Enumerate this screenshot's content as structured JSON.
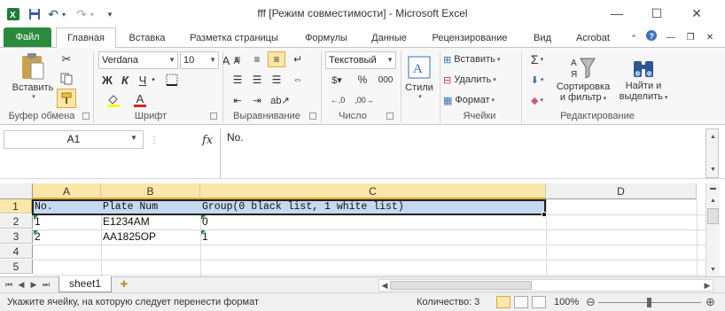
{
  "window": {
    "title": "fff  [Режим совместимости] - Microsoft Excel",
    "minimize": "—",
    "maximize": "☐",
    "close": "✕"
  },
  "qat": {
    "undo": "↶",
    "redo": "↷",
    "customize": "▾"
  },
  "tabs": {
    "file": "Файл",
    "home": "Главная",
    "insert": "Вставка",
    "layout": "Разметка страницы",
    "formulas": "Формулы",
    "data": "Данные",
    "review": "Рецензирование",
    "view": "Вид",
    "acrobat": "Acrobat"
  },
  "ribbon": {
    "clipboard": {
      "paste": "Вставить",
      "label": "Буфер обмена"
    },
    "font": {
      "name": "Verdana",
      "size": "10",
      "bold": "Ж",
      "italic": "К",
      "underline": "Ч",
      "grow": "A",
      "shrink": "A",
      "label": "Шрифт"
    },
    "alignment": {
      "label": "Выравнивание"
    },
    "number": {
      "format": "Текстовый",
      "percent": "%",
      "thousands": "000",
      "label": "Число"
    },
    "styles": {
      "styles": "Стили"
    },
    "cells": {
      "insert": "Вставить",
      "delete": "Удалить",
      "format": "Формат",
      "label": "Ячейки"
    },
    "editing": {
      "sigma": "Σ",
      "sort": "Сортировка и фильтр",
      "sort_line1": "Сортировка",
      "sort_line2": "и фильтр",
      "find_line1": "Найти и",
      "find_line2": "выделить",
      "label": "Редактирование"
    }
  },
  "formula_bar": {
    "name_box": "A1",
    "fx": "fx",
    "content": "No."
  },
  "columns": [
    "A",
    "B",
    "C",
    "D"
  ],
  "rows": [
    "1",
    "2",
    "3",
    "4",
    "5"
  ],
  "cells": {
    "r1": {
      "a": "No.",
      "b": "Plate Num",
      "c": "Group(0 black list, 1 white list)"
    },
    "r2": {
      "a": "1",
      "b": "E1234AM",
      "c": "0"
    },
    "r3": {
      "a": "2",
      "b": "AA1825OP",
      "c": "1"
    }
  },
  "sheet": {
    "tab": "sheet1"
  },
  "status": {
    "text": "Укажите ячейку, на которую следует перенести формат",
    "count": "Количество: 3",
    "zoom": "100%"
  },
  "colors": {
    "file_tab": "#2a8a3e",
    "selection_fill": "#c5d9f1",
    "header_selected": "#fde7a8",
    "error_indicator": "#1f8a3e"
  }
}
